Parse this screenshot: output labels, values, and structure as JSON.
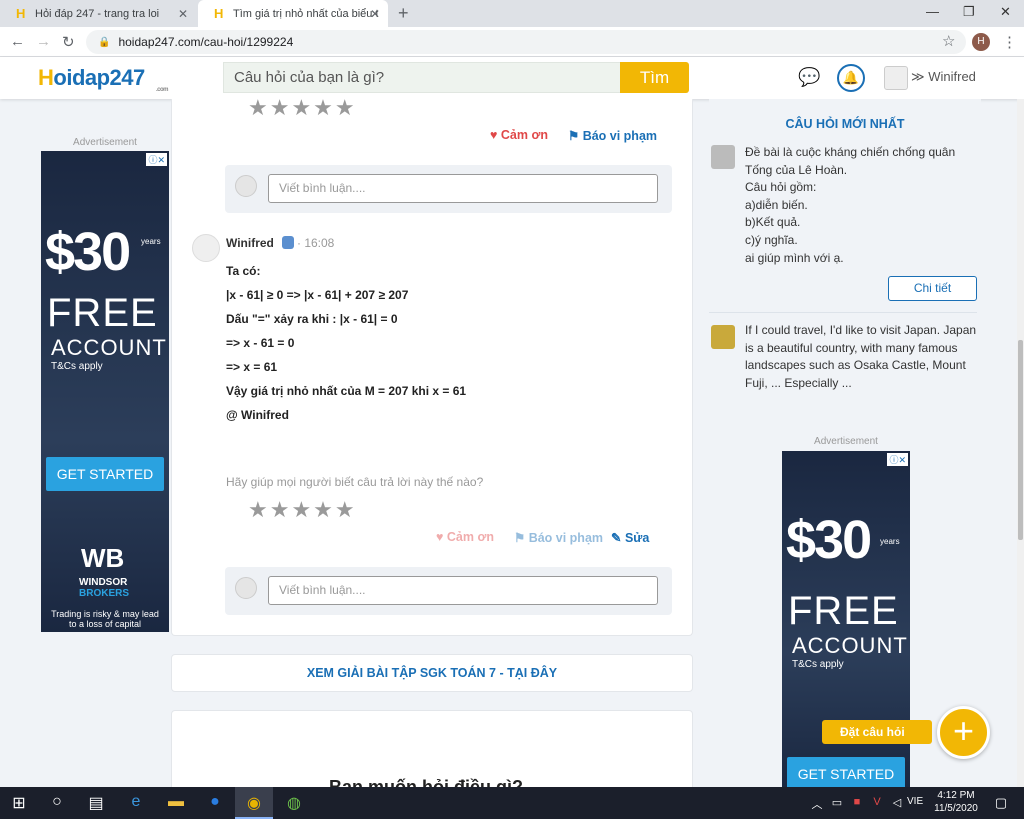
{
  "browser": {
    "tabs": [
      {
        "title": "Hỏi đáp 247 - trang tra loi"
      },
      {
        "title": "Tìm giá trị nhỏ nhất của biểu thứ"
      }
    ],
    "url": "hoidap247.com/cau-hoi/1299224",
    "profile_initial": "H"
  },
  "site": {
    "logo_prefix": "H",
    "logo_rest": "oidap247",
    "logo_sub": ".com",
    "search_placeholder": "Câu hỏi của bạn là gì?",
    "search_button": "Tìm",
    "username": "Winifred"
  },
  "ads": {
    "label": "Advertisement",
    "price": "$30",
    "years": "years",
    "free": "FREE",
    "account": "ACCOUNT",
    "tcs": "T&Cs apply",
    "cta": "GET STARTED",
    "brand_logo": "WB",
    "brand_name_1": "WINDSOR",
    "brand_name_2": "BROKERS",
    "risk": "Trading is risky & may lead to a loss of capital"
  },
  "first_answer": {
    "thank": "Cảm ơn",
    "report": "Báo vi phạm",
    "comment_placeholder": "Viết bình luận...."
  },
  "answer": {
    "author": "Winifred",
    "time": "· 16:08",
    "lines": [
      "Ta có:",
      "|x - 61| ≥ 0 => |x - 61| + 207 ≥ 207",
      "Dấu \"=\" xảy ra khi : |x - 61| = 0",
      "=> x - 61 = 0",
      "=> x = 61",
      "Vậy giá trị nhỏ nhất của M = 207 khi x = 61",
      "@ Winifred"
    ],
    "help_text": "Hãy giúp mọi người biết câu trả lời này thế nào?",
    "thank": "Cảm ơn",
    "report": "Báo vi phạm",
    "edit": "Sửa",
    "comment_placeholder": "Viết bình luận...."
  },
  "sgk_banner": "XEM GIẢI BÀI TẬP SGK TOÁN 7 - TẠI ĐÂY",
  "bottom_title": "Bạn muốn hỏi điều gì?",
  "sidebar": {
    "title": "CÂU HỎI MỚI NHẤT",
    "questions": [
      {
        "text": "Đề bài là cuộc kháng chiến chống quân Tống của Lê Hoàn.\nCâu hỏi gồm:\na)diễn biến.\nb)Kết quả.\nc)ý nghĩa.\nai giúp mình với ạ.",
        "button": "Chi tiết"
      },
      {
        "text": "If I could travel, I'd like to visit Japan. Japan is a beautiful country, with many famous landscapes such as Osaka Castle, Mount Fuji, ... Especially ..."
      }
    ]
  },
  "ask_button": "Đặt câu hỏi",
  "taskbar": {
    "time": "4:12 PM",
    "date": "11/5/2020",
    "lang": "VIE"
  }
}
